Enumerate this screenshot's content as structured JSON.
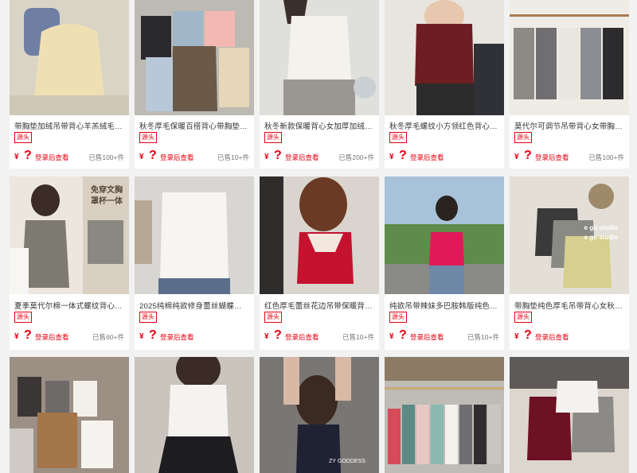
{
  "products": [
    {
      "title": "带胸垫加绒吊带背心羊羔绒毛…",
      "tag": "源头",
      "price_symbol": "¥",
      "price_hidden": "?",
      "login_text": "登录后查看",
      "sold": "已售100+件",
      "bg": "#d9d4c6",
      "shirt": "#ecd8a5"
    },
    {
      "title": "秋冬厚毛保暖百搭背心带胸垫舒…",
      "tag": "源头",
      "price_symbol": "¥",
      "price_hidden": "?",
      "login_text": "登录后查看",
      "sold": "已售10+件",
      "bg": "#bdbab3",
      "shirt": "#6b5a48"
    },
    {
      "title": "秋冬新款保暖背心女加厚加绒…",
      "tag": "源头",
      "price_symbol": "¥",
      "price_hidden": "?",
      "login_text": "登录后查看",
      "sold": "已售200+件",
      "bg": "#dfdfdc",
      "shirt": "#f4f2ec"
    },
    {
      "title": "秋冬厚毛螺纹小方领红色背心…",
      "tag": "源头",
      "price_symbol": "¥",
      "price_hidden": "?",
      "login_text": "登录后查看",
      "sold": "",
      "bg": "#e8e5de",
      "shirt": "#6e1e22"
    },
    {
      "title": "莫代尔可调节吊带背心女带胸…",
      "tag": "源头",
      "price_symbol": "¥",
      "price_hidden": "?",
      "login_text": "登录后查看",
      "sold": "已售100+件",
      "bg": "#efece6",
      "shirt": "#8d8a84"
    },
    {
      "title": "夏季莫代尔棉一体式螺纹背心…",
      "tag": "源头",
      "price_symbol": "¥",
      "price_hidden": "?",
      "login_text": "登录后查看",
      "sold": "已售60+件",
      "bg": "#ece6df",
      "shirt": "#7d7a70",
      "overlay1": "免穿文胸",
      "overlay2": "罩杯一体"
    },
    {
      "title": "2025纯棉纯欲修身蕾丝蝴蝶结…",
      "tag": "源头",
      "price_symbol": "¥",
      "price_hidden": "?",
      "login_text": "登录后查看",
      "sold": "",
      "bg": "#d8d6d2",
      "shirt": "#f6f5f1"
    },
    {
      "title": "红色厚毛蕾丝花边吊带保暖背…",
      "tag": "源头",
      "price_symbol": "¥",
      "price_hidden": "?",
      "login_text": "登录后查看",
      "sold": "已售10+件",
      "bg": "#d9d4cd",
      "shirt": "#c4122f"
    },
    {
      "title": "纯欲吊带辣妹多巴胺韩版纯色…",
      "tag": "源头",
      "price_symbol": "¥",
      "price_hidden": "?",
      "login_text": "登录后查看",
      "sold": "已售10+件",
      "bg": "#a8c3d9",
      "shirt": "#e0195a"
    },
    {
      "title": "带胸垫纯色厚毛吊带背心女秋…",
      "tag": "源头",
      "price_symbol": "¥",
      "price_hidden": "?",
      "login_text": "登录后查看",
      "sold": "",
      "bg": "#e4dfd6",
      "shirt": "#d6cf8e",
      "overlay1": "e go studio",
      "overlay2": "e go studio"
    },
    {
      "title": "",
      "tag": "",
      "price_symbol": "",
      "price_hidden": "",
      "login_text": "",
      "sold": "",
      "bg": "#9c8f84",
      "shirt": "#3a3635"
    },
    {
      "title": "",
      "tag": "",
      "price_symbol": "",
      "price_hidden": "",
      "login_text": "",
      "sold": "",
      "bg": "#c9c4bc",
      "shirt": "#f4f3ef"
    },
    {
      "title": "",
      "tag": "",
      "price_symbol": "",
      "price_hidden": "",
      "login_text": "",
      "sold": "",
      "bg": "#7a7674",
      "shirt": "#1f2233",
      "overlay1": "ZY GODDESS"
    },
    {
      "title": "",
      "tag": "",
      "price_symbol": "",
      "price_hidden": "",
      "login_text": "",
      "sold": "",
      "bg": "#bfbcb6",
      "shirt": "#d84a5a"
    },
    {
      "title": "",
      "tag": "",
      "price_symbol": "",
      "price_hidden": "",
      "login_text": "",
      "sold": "",
      "bg": "#dcd6cf",
      "shirt": "#6c1222"
    }
  ]
}
